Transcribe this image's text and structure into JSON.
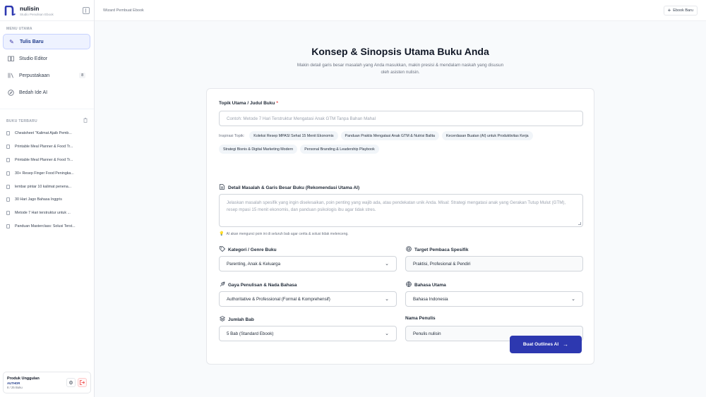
{
  "brand": {
    "name": "nulisin",
    "subtitle": "Studio Penulisan Ebook"
  },
  "sidebar": {
    "menu_label": "MENU UTAMA",
    "items": [
      {
        "label": "Tulis Baru",
        "icon": "pen-icon",
        "active": true
      },
      {
        "label": "Studio Editor",
        "icon": "book-open-icon",
        "active": false
      },
      {
        "label": "Perpustakaan",
        "icon": "library-icon",
        "active": false,
        "badge": "8"
      },
      {
        "label": "Bedah Ide AI",
        "icon": "compass-icon",
        "active": false
      }
    ],
    "recent_label": "BUKU TERBARU",
    "recent_books": [
      "Cheatsheet \"Kalimat Ajaib Pemb...",
      "Printable Meal Planner & Food Tr...",
      "Printable Meal Planner & Food Tr...",
      "30+ Resep Finger Food Peningka...",
      "lembar pintar 10 kalimat penena...",
      "30 Hari Jago Bahasa Inggris",
      "Metode 7 Hari terstruktur untuk ...",
      "Panduan Masterclass: Solusi Terst..."
    ],
    "footer": {
      "plan_name": "Produk Unggulan",
      "tier": "AUTHOR",
      "count": "8 / 25 Buku"
    }
  },
  "topbar": {
    "title": "Wizard Pembuat Ebook",
    "new_button": "Ebook Baru"
  },
  "hero": {
    "title": "Konsep & Sinopsis Utama Buku Anda",
    "subtitle": "Makin detail garis besar masalah yang Anda masukkan, makin presisi & mendalam naskah yang disusun oleh asisten nulisin."
  },
  "form": {
    "topic": {
      "label": "Topik Utama / Judul Buku",
      "required_mark": "*",
      "placeholder": "Contoh: Metode 7 Hari Terstruktur Mengatasi Anak GTM Tanpa Bahan Mahal"
    },
    "inspiration": {
      "label": "Inspirasi Topik:",
      "chips": [
        "Koleksi Resep MPASI Sehat 15 Menit Ekonomis",
        "Panduan Praktis Mengatasi Anak GTM & Nutrisi Balita",
        "Kecerdasan Buatan (AI) untuk Produktivitas Kerja",
        "Strategi Bisnis & Digital Marketing Modern",
        "Personal Branding & Leadership Playbook"
      ]
    },
    "detail": {
      "label": "Detail Masalah & Garis Besar Buku (Rekomendasi Utama AI)",
      "placeholder": "Jelaskan masalah spesifik yang ingin diselesaikan, poin penting yang wajib ada, atau pendekatan unik Anda. Misal: Strategi mengatasi anak yang Gerakan Tutup Mulut (GTM), resep mpasi 15 menit ekonomis, dan panduan psikologis ibu agar tidak stres.",
      "hint": "AI akan mengunci poin ini di seluruh bab agar cerita & solusi tidak melenceng."
    },
    "category": {
      "label": "Kategori / Genre Buku",
      "value": "Parenting, Anak & Keluarga"
    },
    "audience": {
      "label": "Target Pembaca Spesifik",
      "value": "Praktisi, Profesional & Pendiri"
    },
    "style": {
      "label": "Gaya Penulisan & Nada Bahasa",
      "value": "Authoritative & Professional (Formal & Komprehensif)"
    },
    "language": {
      "label": "Bahasa Utama",
      "value": "Bahasa Indonesia"
    },
    "chapters": {
      "label": "Jumlah Bab",
      "value": "5 Bab (Standard Ebook)"
    },
    "author": {
      "label": "Nama Penulis",
      "value": "Penulis nulisin"
    },
    "submit": "Buat Outlines AI"
  },
  "colors": {
    "accent": "#2d38b0",
    "active_bg": "#eef2ff",
    "danger": "#ef4444"
  }
}
